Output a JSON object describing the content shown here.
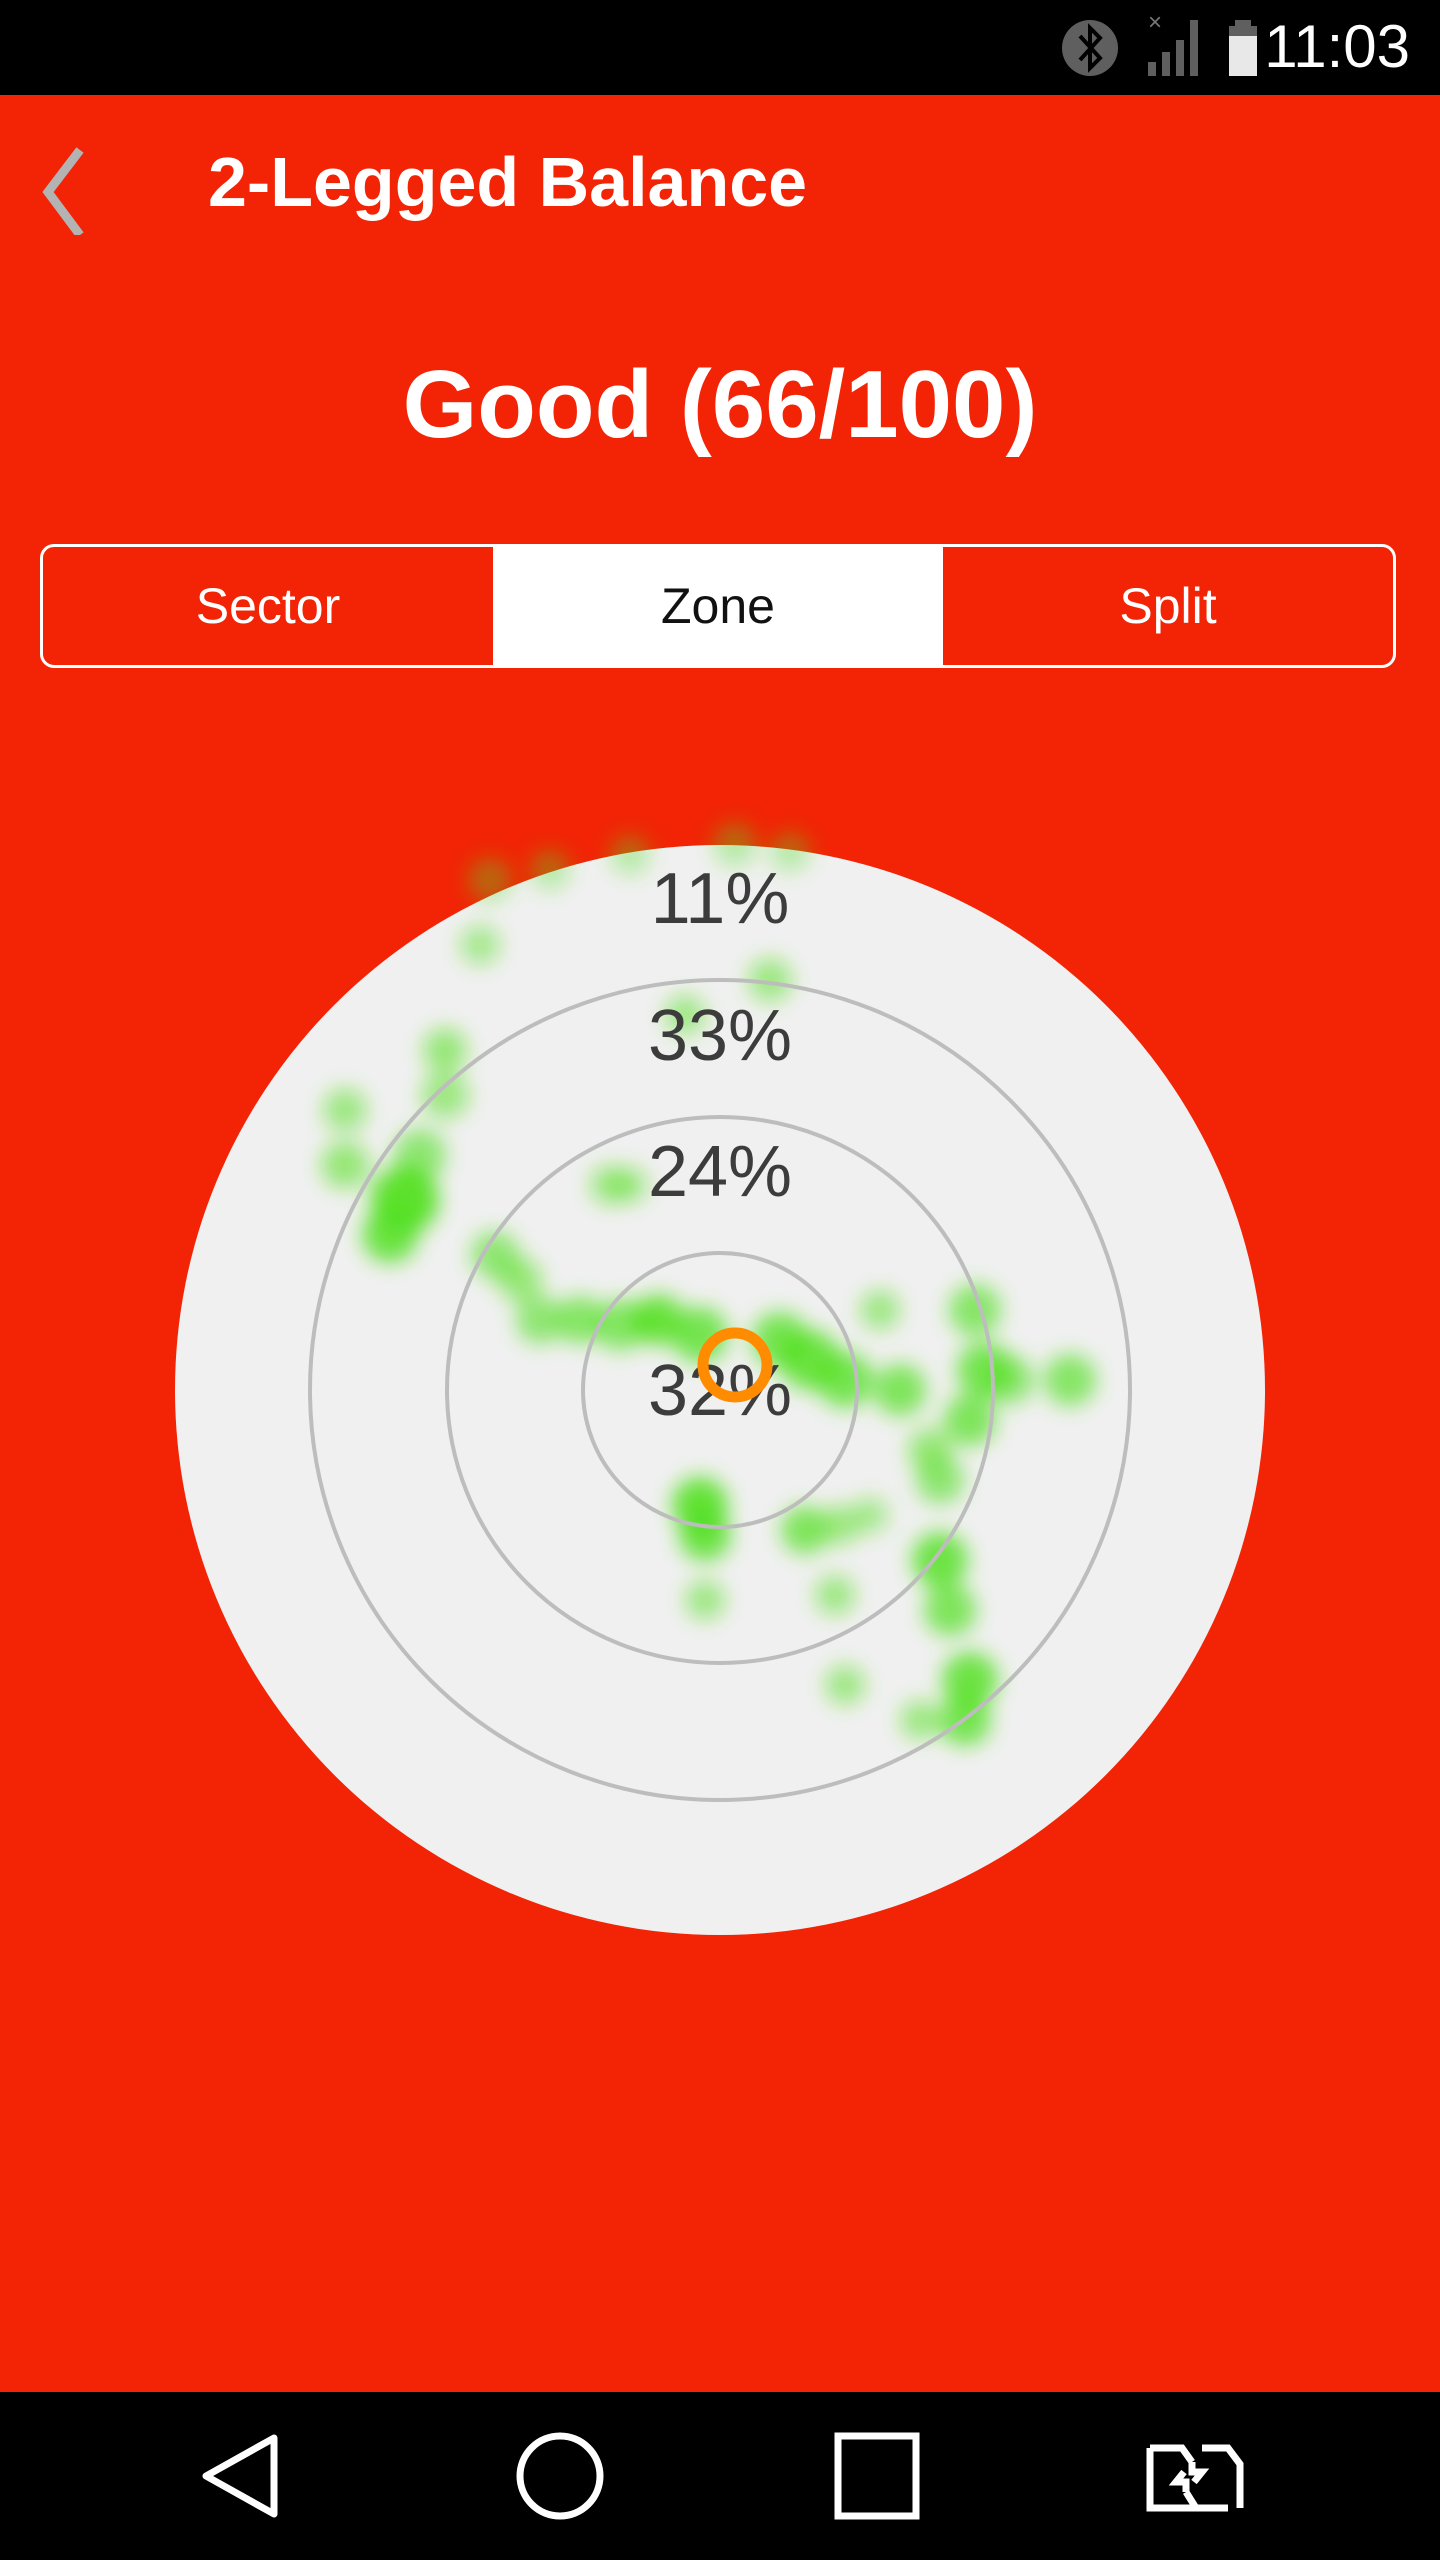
{
  "status_bar": {
    "time": "11:03",
    "icons": [
      "bluetooth-icon",
      "signal-no-data-icon",
      "battery-icon"
    ]
  },
  "app_bar": {
    "back_icon": "chevron-left-icon",
    "title": "2-Legged Balance"
  },
  "score": {
    "text": "Good (66/100)",
    "rating": "Good",
    "value": 66,
    "max": 100
  },
  "tabs": [
    {
      "label": "Sector",
      "active": false
    },
    {
      "label": "Zone",
      "active": true
    },
    {
      "label": "Split",
      "active": false
    }
  ],
  "zones": [
    {
      "label": "11%",
      "zone": "outer"
    },
    {
      "label": "33%",
      "zone": "third"
    },
    {
      "label": "24%",
      "zone": "second"
    },
    {
      "label": "32%",
      "zone": "center"
    }
  ],
  "colors": {
    "accent": "#f22405",
    "target_bg": "#f0f0f0",
    "ring": "#bdbdbd",
    "heat": "#4ee01a",
    "marker": "#ff8c00",
    "zone_text": "#3c3c3c"
  },
  "nav_bar": {
    "buttons": [
      "back-triangle-icon",
      "home-circle-icon",
      "recents-square-icon",
      "switch-app-icon"
    ]
  }
}
